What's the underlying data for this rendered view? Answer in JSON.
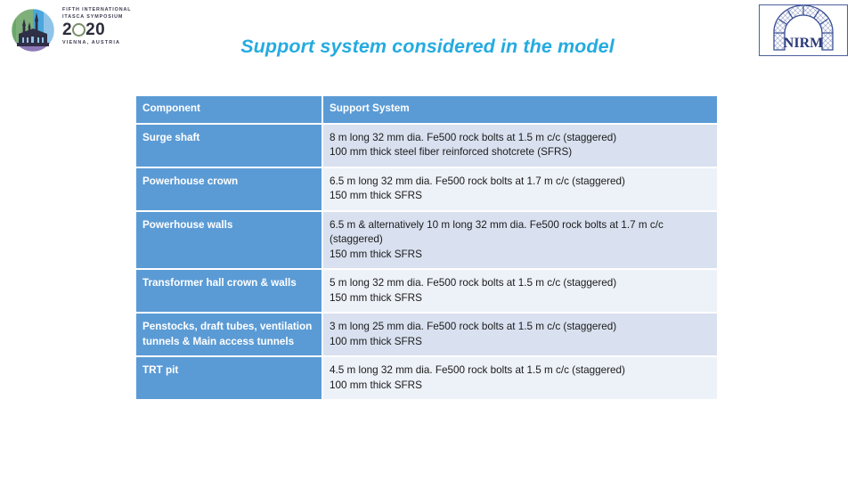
{
  "header": {
    "itasca_logo": {
      "name": "itasca-symposium-logo",
      "line1": "FIFTH INTERNATIONAL",
      "line2": "ITASCA SYMPOSIUM",
      "year_prefix": "2",
      "year_suffix": "20",
      "city": "VIENNA, AUSTRIA"
    },
    "nirm_logo": {
      "name": "nirm-logo",
      "text": "NIRM"
    }
  },
  "title": "Support system considered in the model",
  "colors": {
    "title": "#25ABE0",
    "header_blue": "#5B9BD5",
    "row_odd": "#D9E1F0",
    "row_even": "#EDF1F8",
    "nirm_blue": "#3a4f93"
  },
  "table": {
    "columns": [
      "Component",
      "Support System"
    ],
    "rows": [
      {
        "component": "Surge shaft",
        "spec": [
          "8 m long 32 mm dia. Fe500 rock bolts at 1.5 m c/c (staggered)",
          "100 mm thick steel fiber reinforced shotcrete (SFRS)"
        ]
      },
      {
        "component": "Powerhouse crown",
        "spec": [
          "6.5 m long 32 mm dia. Fe500 rock bolts at 1.7 m c/c (staggered)",
          "150 mm thick SFRS"
        ]
      },
      {
        "component": "Powerhouse walls",
        "spec": [
          "6.5 m & alternatively 10 m long 32 mm dia. Fe500 rock bolts at 1.7 m c/c (staggered)",
          "150 mm thick SFRS"
        ]
      },
      {
        "component": "Transformer hall crown & walls",
        "spec": [
          "5 m long 32 mm dia. Fe500 rock bolts at 1.5 m c/c (staggered)",
          "150 mm thick SFRS"
        ]
      },
      {
        "component": "Penstocks, draft tubes, ventilation tunnels & Main access tunnels",
        "spec": [
          "3 m long 25 mm dia. Fe500 rock bolts at 1.5 m c/c (staggered)",
          "100 mm thick SFRS"
        ]
      },
      {
        "component": "TRT pit",
        "spec": [
          "4.5 m long 32 mm dia. Fe500 rock bolts at 1.5 m c/c (staggered)",
          "100 mm thick SFRS"
        ]
      }
    ]
  }
}
